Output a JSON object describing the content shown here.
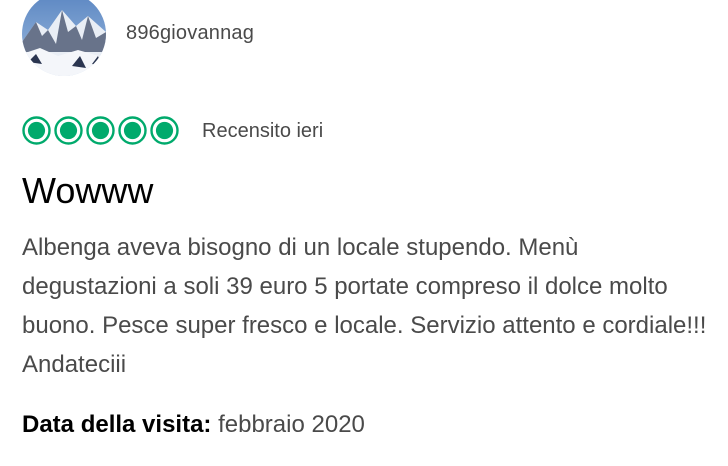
{
  "review": {
    "username": "896giovannag",
    "rating": 5,
    "rating_color": "#00aa6c",
    "reviewed_label": "Recensito ieri",
    "title": "Wowww",
    "body": "Albenga aveva bisogno di un locale stupendo. Menù degustazioni a soli 39 euro 5 portate compreso il dolce molto buono. Pesce super fresco e locale. Servizio attento e cordiale!!! Andateciii",
    "visit_label": "Data della visita:",
    "visit_date": "febbraio 2020"
  }
}
